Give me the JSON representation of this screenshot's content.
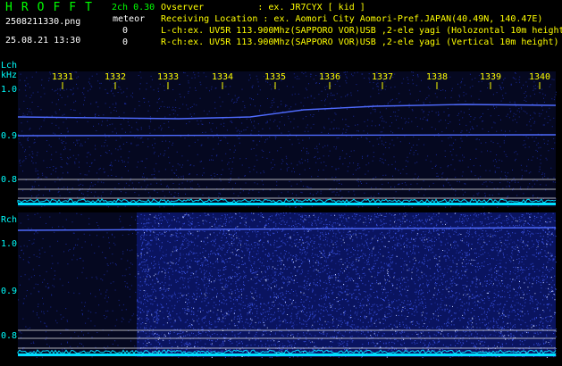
{
  "header": {
    "app_title": "HROFFT",
    "filename": "2508211330.png",
    "datetime": "25.08.21 13:30",
    "mode": "2ch 0.30",
    "meteor_label": "meteor",
    "l_count": "0",
    "r_count": "0",
    "observer_line": "Ovserver          : ex. JR7CYX [ kid ]",
    "location_line": "Receiving Location : ex. Aomori City Aomori-Pref.JAPAN(40.49N, 140.47E)",
    "lch_line": "L-ch:ex. UV5R 113.900Mhz(SAPPORO VOR)USB ,2-ele yagi (Holozontal 10m height)",
    "rch_line": "R-ch:ex. UV5R 113.900Mhz(SAPPORO VOR)USB ,2-ele yagi (Vertical 10m height)"
  },
  "lch": {
    "label": "Lch",
    "unit": "kHz",
    "freq_ticks": [
      "1.0",
      "0.9",
      "0.8"
    ]
  },
  "rch": {
    "label": "Rch",
    "freq_ticks": [
      "1.0",
      "0.9",
      "0.8"
    ]
  },
  "time_ticks": [
    "1331",
    "1332",
    "1333",
    "1334",
    "1335",
    "1336",
    "1337",
    "1338",
    "1339",
    "1340"
  ],
  "colors": {
    "label_green": "#00ff00",
    "label_cyan": "#00ffff",
    "tick_yellow": "#ffff00",
    "noise_blue": "#1a2a9a",
    "signal_blue": "#4f6bff",
    "baseline_cyan": "#00e0ff",
    "grid_white": "#e8e8e8"
  }
}
